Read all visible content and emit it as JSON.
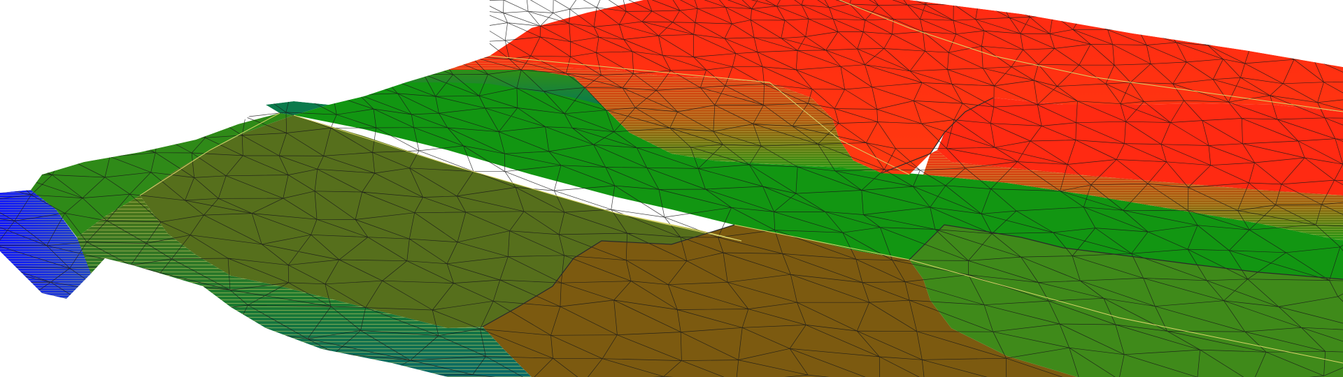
{
  "viewport": {
    "background_color": "#ffffff",
    "view_kind": "3d-perspective-terrain-mesh",
    "mesh_style": "triangulated-surface-with-contour-bands",
    "edge_color": "#1a1a1a",
    "contour_color": "#d9d46a"
  },
  "colors": {
    "high_elevation": "#ff2a12",
    "upper_mid_elevation": "#3f8a1a",
    "mid_elevation": "#129612",
    "lower_mid_elevation": "#566f1c",
    "low_terrace": "#7c5a10",
    "lowest_elevation": "#0a12ff",
    "slope_teal": "#0b7a4c"
  },
  "legend_visible": false,
  "axes_visible": false
}
